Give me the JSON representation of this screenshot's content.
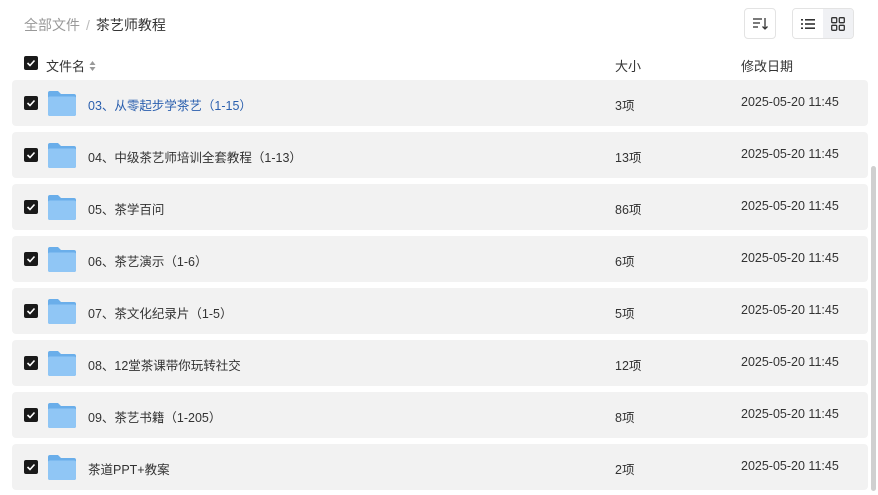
{
  "breadcrumb": {
    "root": "全部文件",
    "separator": "/",
    "current": "茶艺师教程"
  },
  "toolbar": {
    "sort_icon": "sort-icon",
    "list_view_icon": "list-view-icon",
    "grid_view_icon": "grid-view-icon",
    "active_view": "list"
  },
  "table": {
    "headers": {
      "name": "文件名",
      "size": "大小",
      "modified": "修改日期"
    },
    "rows": [
      {
        "name": "03、从零起步学茶艺（1-15）",
        "size": "3项",
        "modified": "2025-05-20 11:45",
        "checked": true,
        "hovered": true
      },
      {
        "name": "04、中级茶艺师培训全套教程（1-13）",
        "size": "13项",
        "modified": "2025-05-20 11:45",
        "checked": true
      },
      {
        "name": "05、茶学百问",
        "size": "86项",
        "modified": "2025-05-20 11:45",
        "checked": true
      },
      {
        "name": "06、茶艺演示（1-6）",
        "size": "6项",
        "modified": "2025-05-20 11:45",
        "checked": true
      },
      {
        "name": "07、茶文化纪录片（1-5）",
        "size": "5项",
        "modified": "2025-05-20 11:45",
        "checked": true
      },
      {
        "name": "08、12堂茶课带你玩转社交",
        "size": "12项",
        "modified": "2025-05-20 11:45",
        "checked": true
      },
      {
        "name": "09、茶艺书籍（1-205）",
        "size": "8项",
        "modified": "2025-05-20 11:45",
        "checked": true
      },
      {
        "name": "茶道PPT+教案",
        "size": "2项",
        "modified": "2025-05-20 11:45",
        "checked": true
      }
    ]
  },
  "colors": {
    "link": "#2a5fae",
    "row_bg": "#f2f2f2",
    "checkbox": "#1a1a1a",
    "folder": "#7fb8f0"
  }
}
